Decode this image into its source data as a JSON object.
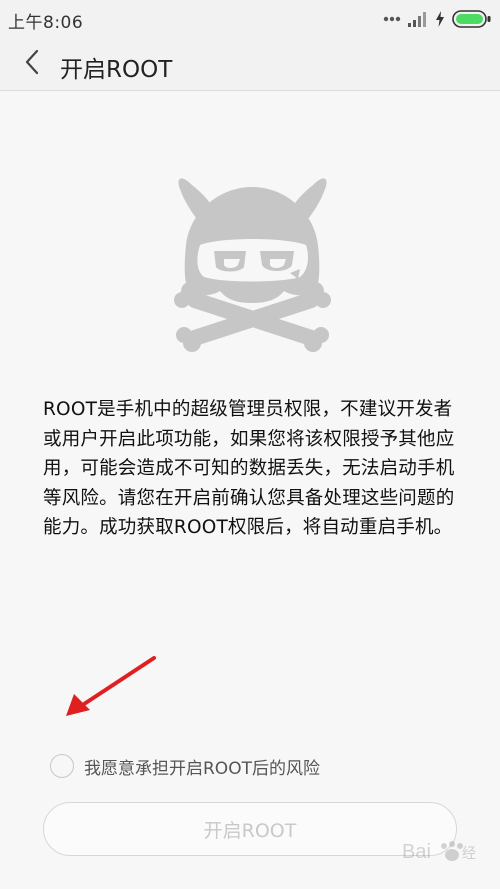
{
  "status_bar": {
    "time": "上午8:06",
    "icons": [
      "more-dots-icon",
      "signal-icon",
      "charging-icon",
      "battery-icon"
    ]
  },
  "header": {
    "back_icon": "chevron-left-icon",
    "title": "开启ROOT"
  },
  "mascot": {
    "icon": "skull-bunny-icon",
    "color": "#c6c6c6"
  },
  "description": "ROOT是手机中的超级管理员权限，不建议开发者或用户开启此项功能，如果您将该权限授予其他应用，可能会造成不可知的数据丢失，无法启动手机等风险。请您在开启前确认您具备处理这些问题的能力。成功获取ROOT权限后，将自动重启手机。",
  "arrow": {
    "icon": "red-arrow-icon",
    "color": "#e02020"
  },
  "consent": {
    "label": "我愿意承担开启ROOT后的风险",
    "checked": false
  },
  "enable_button": {
    "label": "开启ROOT",
    "enabled": false
  },
  "colors": {
    "background": "#f7f7f7",
    "header": "#f2f2f2",
    "battery_green": "#4cd964",
    "disabled_text": "#c9c9c9"
  }
}
